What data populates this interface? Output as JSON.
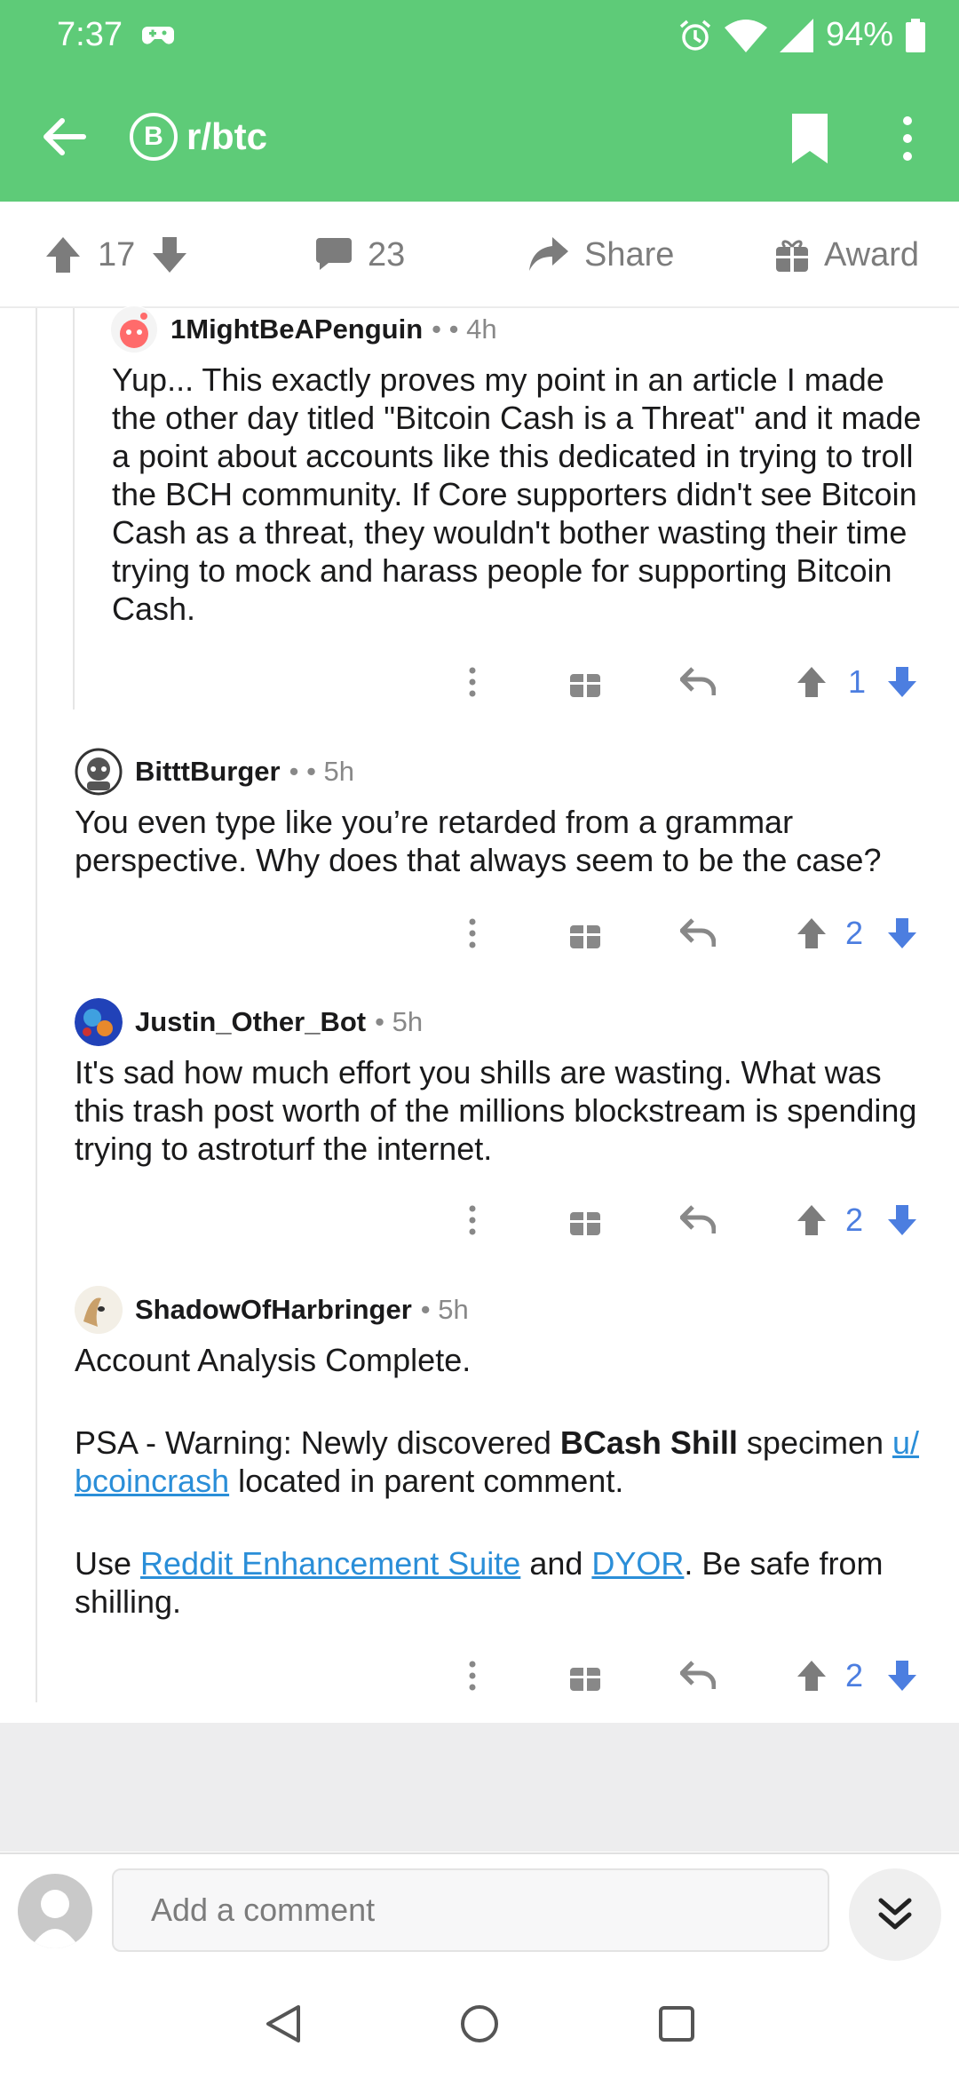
{
  "status_bar": {
    "time": "7:37",
    "battery": "94%"
  },
  "app_bar": {
    "subreddit": "r/btc",
    "badge": "B"
  },
  "post_actions": {
    "votes": "17",
    "comments": "23",
    "share_label": "Share",
    "award_label": "Award"
  },
  "comments": [
    {
      "author": "1MightBeAPenguin",
      "meta": "• • 4h",
      "body": "Yup... This exactly proves my point in an article I made the other day titled \"Bitcoin Cash is a Threat\" and it made a point about accounts like this dedicated in trying to troll the BCH community. If Core supporters didn't see Bitcoin Cash as a threat, they wouldn't bother wasting their time trying to mock and harass people for supporting Bitcoin Cash.",
      "score": "1"
    },
    {
      "author": "BitttBurger",
      "meta": "• • 5h",
      "body": "You even type like you’re retarded from a grammar perspective.  Why does that always seem to be the case?",
      "score": "2"
    },
    {
      "author": "Justin_Other_Bot",
      "meta": "• 5h",
      "body": "It's sad how much effort you shills are wasting. What was this trash post worth of the millions blockstream is spending trying to astroturf the internet.",
      "score": "2"
    },
    {
      "author": "ShadowOfHarbringer",
      "meta": "• 5h",
      "line1": "Account Analysis Complete.",
      "psa_prefix": "PSA - Warning: Newly discovered ",
      "psa_bold": "BCash Shill",
      "psa_mid": " specimen ",
      "psa_link": "u/​bcoincrash",
      "psa_suffix": " located in parent comment.",
      "use_prefix": "Use ",
      "use_link1": "Reddit Enhancement Suite",
      "use_and": " and ",
      "use_link2": "DYOR",
      "use_suffix": ". Be safe from shilling.",
      "score": "2"
    }
  ],
  "composer": {
    "placeholder": "Add a comment"
  },
  "colors": {
    "brand_green": "#5ecb78",
    "vote_blue": "#4c7ee0",
    "link_blue": "#2a8ed8"
  }
}
